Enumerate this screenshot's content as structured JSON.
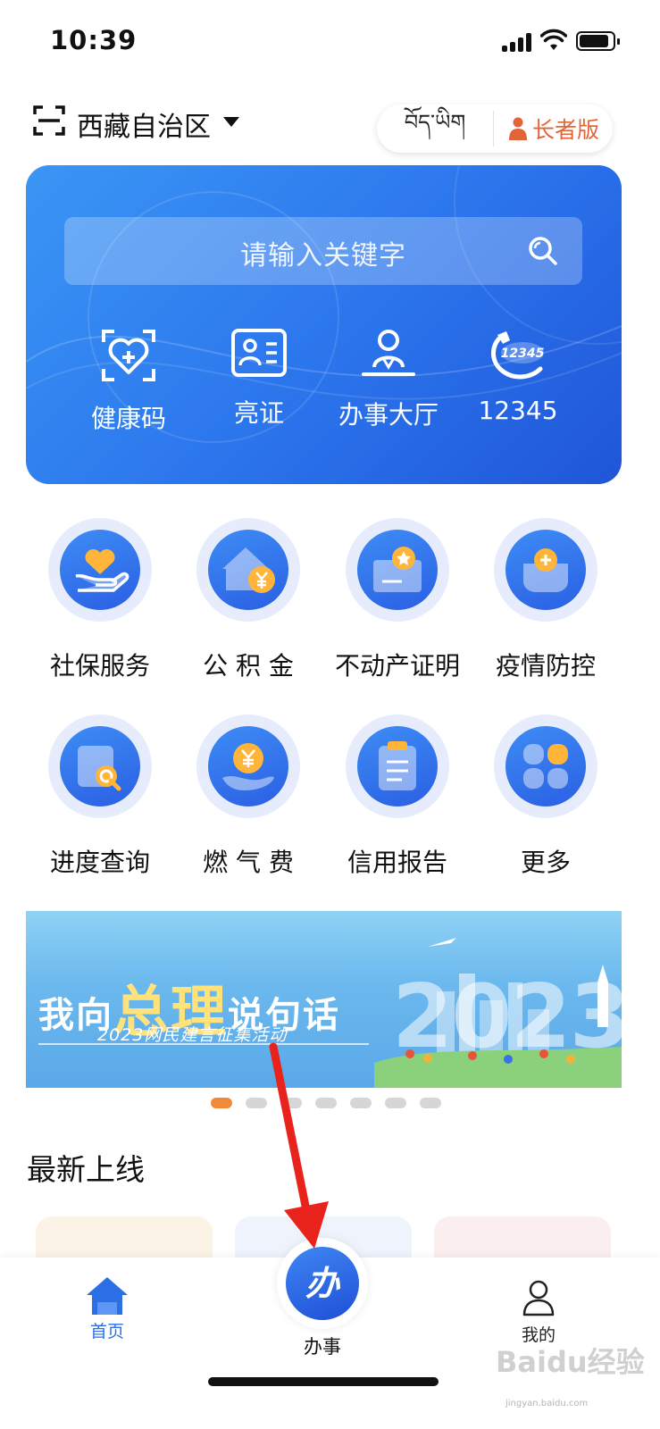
{
  "status_bar": {
    "time": "10:39"
  },
  "header": {
    "region": "西藏自治区",
    "lang_tibetan": "བོད་ཡིག",
    "elder_mode": "长者版"
  },
  "hero": {
    "search_placeholder": "请输入关键字",
    "quick_actions": [
      {
        "label": "健康码",
        "icon": "health-code-icon"
      },
      {
        "label": "亮证",
        "icon": "id-card-icon"
      },
      {
        "label": "办事大厅",
        "icon": "service-hall-icon"
      },
      {
        "label": "12345",
        "icon": "hotline-12345-icon"
      }
    ]
  },
  "services": [
    {
      "label": "社保服务",
      "icon": "social-security-icon"
    },
    {
      "label": "公 积 金",
      "icon": "housing-fund-icon"
    },
    {
      "label": "不动产证明",
      "icon": "property-certificate-icon"
    },
    {
      "label": "疫情防控",
      "icon": "epidemic-control-icon"
    },
    {
      "label": "进度查询",
      "icon": "progress-query-icon"
    },
    {
      "label": "燃 气 费",
      "icon": "gas-fee-icon"
    },
    {
      "label": "信用报告",
      "icon": "credit-report-icon"
    },
    {
      "label": "更多",
      "icon": "more-icon"
    }
  ],
  "promo": {
    "title_prefix": "我向",
    "title_big": "总理",
    "title_suffix": "说句话",
    "subtitle": "2023网民建言征集活动",
    "year": "2023",
    "carousel_active_index": 0,
    "carousel_count": 7
  },
  "latest_section": {
    "title": "最新上线"
  },
  "tabbar": {
    "home": "首页",
    "center_glyph": "办",
    "center_label": "办事",
    "mine": "我的"
  },
  "watermark": {
    "brand": "Baidu经验",
    "url": "jingyan.baidu.com"
  },
  "colors": {
    "primary_blue": "#2b74ec",
    "elder_orange": "#e2653a",
    "active_dot": "#f08a3b",
    "arrow_red": "#e8231c"
  }
}
